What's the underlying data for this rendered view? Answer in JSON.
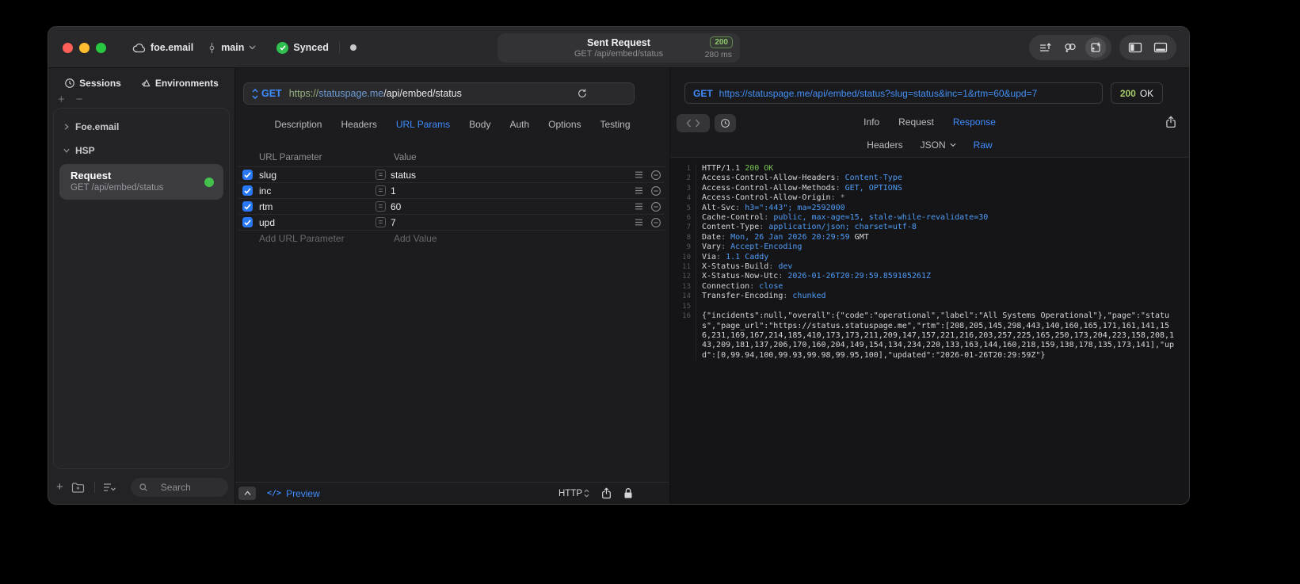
{
  "glyphs": {
    "plus": "+",
    "minus": "−",
    "eq": "=",
    "code": "</>"
  },
  "titlebar": {
    "project": "foe.email",
    "branch": "main",
    "sync_label": "Synced",
    "center": {
      "title": "Sent Request",
      "status_badge": "200",
      "subtitle": "GET /api/embed/status",
      "duration": "280 ms"
    }
  },
  "sidebar": {
    "tabs": [
      {
        "label": "Sessions"
      },
      {
        "label": "Environments"
      }
    ],
    "tree": {
      "group1": {
        "label": "Foe.email"
      },
      "group2": {
        "label": "HSP"
      },
      "request": {
        "title": "Request",
        "subtitle": "GET /api/embed/status"
      }
    },
    "search_placeholder": "Search"
  },
  "request_editor": {
    "method": "GET",
    "url_scheme": "https://",
    "url_host": "statuspage.me",
    "url_path": "/api/embed/status",
    "tabs": [
      {
        "label": "Description"
      },
      {
        "label": "Headers"
      },
      {
        "label": "URL Params",
        "active": true
      },
      {
        "label": "Body"
      },
      {
        "label": "Auth"
      },
      {
        "label": "Options"
      },
      {
        "label": "Testing"
      }
    ],
    "params": {
      "col_name": "URL Parameter",
      "col_value": "Value",
      "rows": [
        {
          "name": "slug",
          "value": "status",
          "enabled": true
        },
        {
          "name": "inc",
          "value": "1",
          "enabled": true
        },
        {
          "name": "rtm",
          "value": "60",
          "enabled": true
        },
        {
          "name": "upd",
          "value": "7",
          "enabled": true
        }
      ],
      "add_name": "Add URL Parameter",
      "add_value": "Add Value"
    },
    "footer": {
      "preview": "Preview",
      "protocol": "HTTP"
    }
  },
  "response_viewer": {
    "method": "GET",
    "url": "https://statuspage.me/api/embed/status?slug=status&inc=1&rtm=60&upd=7",
    "status_code": "200",
    "status_text": "OK",
    "tabs": [
      {
        "label": "Info"
      },
      {
        "label": "Request"
      },
      {
        "label": "Response",
        "active": true
      }
    ],
    "subtabs": [
      {
        "label": "Headers"
      },
      {
        "label": "JSON",
        "dropdown": true
      },
      {
        "label": "Raw",
        "active": true
      }
    ],
    "lines": [
      {
        "n": "1",
        "s": [
          [
            "HTTP/1.1 ",
            "w"
          ],
          [
            "200 OK",
            "g"
          ]
        ]
      },
      {
        "n": "2",
        "s": [
          [
            "Access-Control-Allow-Headers",
            "w"
          ],
          [
            ": ",
            "m"
          ],
          [
            "Content-Type",
            "b"
          ]
        ]
      },
      {
        "n": "3",
        "s": [
          [
            "Access-Control-Allow-Methods",
            "w"
          ],
          [
            ": ",
            "m"
          ],
          [
            "GET, OPTIONS",
            "b"
          ]
        ]
      },
      {
        "n": "4",
        "s": [
          [
            "Access-Control-Allow-Origin",
            "w"
          ],
          [
            ": ",
            "m"
          ],
          [
            "*",
            "m"
          ]
        ]
      },
      {
        "n": "5",
        "s": [
          [
            "Alt-Svc",
            "w"
          ],
          [
            ": ",
            "m"
          ],
          [
            "h3=\":443\"; ma=2592000",
            "b"
          ]
        ]
      },
      {
        "n": "6",
        "s": [
          [
            "Cache-Control",
            "w"
          ],
          [
            ": ",
            "m"
          ],
          [
            "public, max-age=15, stale-while-revalidate=30",
            "b"
          ]
        ]
      },
      {
        "n": "7",
        "s": [
          [
            "Content-Type",
            "w"
          ],
          [
            ": ",
            "m"
          ],
          [
            "application/json; charset=utf-8",
            "b"
          ]
        ]
      },
      {
        "n": "8",
        "s": [
          [
            "Date",
            "w"
          ],
          [
            ": ",
            "m"
          ],
          [
            "Mon, 26 Jan 2026 20:29:59",
            "b"
          ],
          [
            " GMT",
            "w"
          ]
        ]
      },
      {
        "n": "9",
        "s": [
          [
            "Vary",
            "w"
          ],
          [
            ": ",
            "m"
          ],
          [
            "Accept-Encoding",
            "b"
          ]
        ]
      },
      {
        "n": "10",
        "s": [
          [
            "Via",
            "w"
          ],
          [
            ": ",
            "m"
          ],
          [
            "1.1 Caddy",
            "b"
          ]
        ]
      },
      {
        "n": "11",
        "s": [
          [
            "X-Status-Build",
            "w"
          ],
          [
            ": ",
            "m"
          ],
          [
            "dev",
            "b"
          ]
        ]
      },
      {
        "n": "12",
        "s": [
          [
            "X-Status-Now-Utc",
            "w"
          ],
          [
            ": ",
            "m"
          ],
          [
            "2026-01-26T20:29:59.859105261Z",
            "b"
          ]
        ]
      },
      {
        "n": "13",
        "s": [
          [
            "Connection",
            "w"
          ],
          [
            ": ",
            "m"
          ],
          [
            "close",
            "b"
          ]
        ]
      },
      {
        "n": "14",
        "s": [
          [
            "Transfer-Encoding",
            "w"
          ],
          [
            ": ",
            "m"
          ],
          [
            "chunked",
            "b"
          ]
        ]
      },
      {
        "n": "15",
        "s": []
      },
      {
        "n": "16",
        "s": [
          [
            "{\"incidents\":null,\"overall\":{\"code\":\"operational\",\"label\":\"All Systems Operational\"},\"page\":\"status\",\"page_url\":\"https://status.statuspage.me\",\"rtm\":[208,205,145,298,443,140,160,165,171,161,141,156,231,169,167,214,185,410,173,173,211,209,147,157,221,216,203,257,225,165,250,173,204,223,158,208,143,209,181,137,206,170,160,204,149,154,134,234,220,133,163,144,160,218,159,138,178,135,173,141],\"upd\":[0,99.94,100,99.93,99.98,99.95,100],\"updated\":\"2026-01-26T20:29:59Z\"}",
            "w"
          ]
        ]
      }
    ]
  },
  "colors": {
    "accent": "#3f8cff",
    "value_blue": "#4f9cf7",
    "ok_green": "#77c353",
    "badge_green": "#8cc96a",
    "checkbox_blue": "#2979f6"
  }
}
